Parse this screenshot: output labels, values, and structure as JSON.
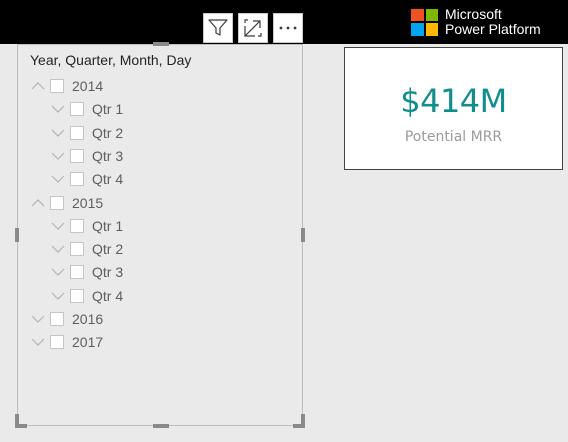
{
  "brand": {
    "line1": "Microsoft",
    "line2": "Power Platform",
    "logo_colors": [
      "#f25022",
      "#7fba00",
      "#00a4ef",
      "#ffb900"
    ]
  },
  "visual_header": {
    "icons": [
      "filter-icon",
      "focus-mode-icon",
      "more-options-icon"
    ]
  },
  "slicer": {
    "title": "Year, Quarter, Month, Day",
    "items": [
      {
        "label": "2014",
        "level": 0,
        "expanded": true
      },
      {
        "label": "Qtr 1",
        "level": 1,
        "expanded": false
      },
      {
        "label": "Qtr 2",
        "level": 1,
        "expanded": false
      },
      {
        "label": "Qtr 3",
        "level": 1,
        "expanded": false
      },
      {
        "label": "Qtr 4",
        "level": 1,
        "expanded": false
      },
      {
        "label": "2015",
        "level": 0,
        "expanded": true
      },
      {
        "label": "Qtr 1",
        "level": 1,
        "expanded": false
      },
      {
        "label": "Qtr 2",
        "level": 1,
        "expanded": false
      },
      {
        "label": "Qtr 3",
        "level": 1,
        "expanded": false
      },
      {
        "label": "Qtr 4",
        "level": 1,
        "expanded": false
      },
      {
        "label": "2016",
        "level": 0,
        "expanded": false
      },
      {
        "label": "2017",
        "level": 0,
        "expanded": false
      }
    ]
  },
  "card": {
    "value": "$414M",
    "label": "Potential MRR",
    "value_color": "#118d8d"
  }
}
